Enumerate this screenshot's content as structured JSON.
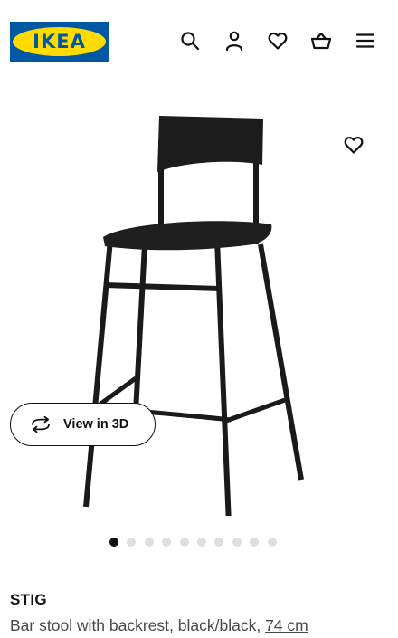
{
  "header": {
    "logo_text": "IKEA",
    "icons": [
      "search-icon",
      "account-icon",
      "favourites-icon",
      "basket-icon",
      "menu-icon"
    ]
  },
  "colors": {
    "brand_blue": "#0058a3",
    "brand_yellow": "#ffdb00",
    "text_primary": "#111111",
    "text_secondary": "#484848"
  },
  "gallery": {
    "view3d_label": "View in 3D",
    "dot_count": 10,
    "active_index": 0
  },
  "product": {
    "name": "STIG",
    "description": "Bar stool with backrest, black/black, ",
    "size": "74 cm"
  }
}
